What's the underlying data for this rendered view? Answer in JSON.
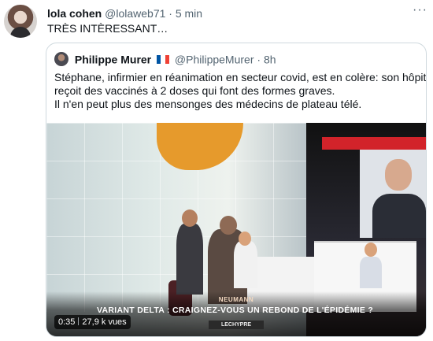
{
  "tweet": {
    "author_name": "lola cohen",
    "author_handle": "@lolaweb71",
    "separator": "·",
    "time": "5 min",
    "text": "TRÈS INTÈRESSANT…",
    "more_icon": "more-horizontal-icon"
  },
  "quote": {
    "author_name": "Philippe Murer",
    "flag": "france-flag-icon",
    "author_handle": "@PhilippeMurer",
    "separator": "·",
    "time": "8h",
    "lines": [
      "Stéphane, infirmier en réanimation en secteur covid, est en colère: son hôpital",
      "reçoit des vaccinés à 2 doses qui font des formes graves.",
      "Il n'en peut plus des mensonges des médecins de plateau télé."
    ],
    "flag_colors": [
      "#0055a4",
      "#ffffff",
      "#ef4135"
    ]
  },
  "video": {
    "guest_name": "NEUMANN",
    "headline": "VARIANT DELTA : CRAIGNEZ-VOUS UN REBOND DE L'ÉPIDÉMIE ?",
    "channel": "LECHYPRE",
    "duration": "0:35",
    "views": "27,9 k vues"
  }
}
